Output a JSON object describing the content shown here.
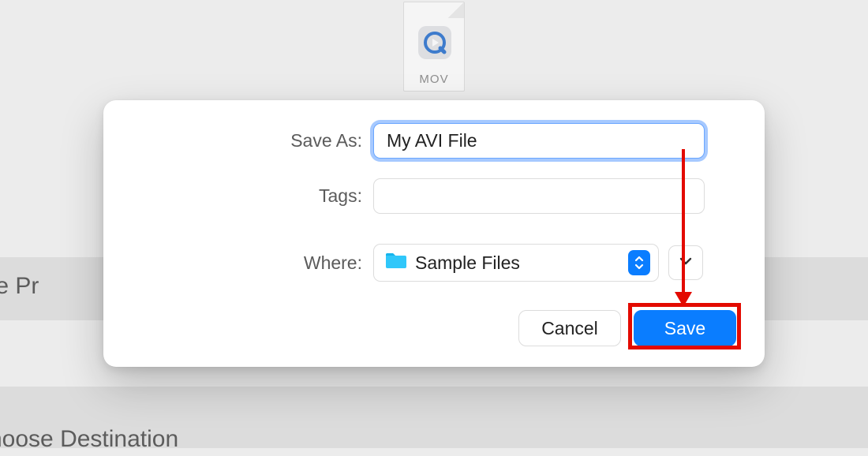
{
  "background": {
    "text1": "oose Pr",
    "text2": "hoose Destination"
  },
  "doc": {
    "ext_label": "MOV"
  },
  "dialog": {
    "labels": {
      "save_as": "Save As:",
      "tags": "Tags:",
      "where": "Where:"
    },
    "save_as_value": "My AVI File",
    "tags_value": "",
    "where_value": "Sample Files",
    "buttons": {
      "cancel": "Cancel",
      "save": "Save"
    }
  }
}
